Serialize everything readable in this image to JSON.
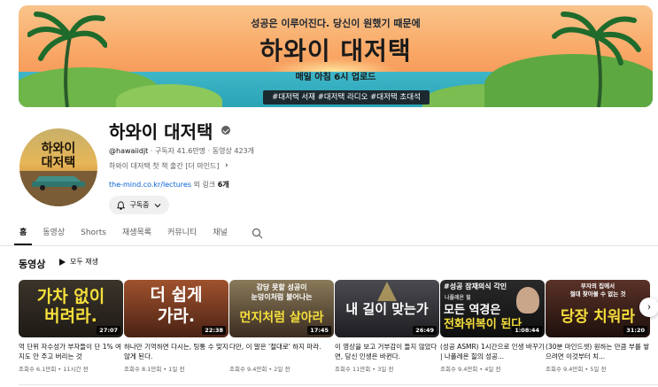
{
  "banner": {
    "top_text": "성공은 이루어진다. 당신이 원했기 때문에",
    "title": "하와이 대저택",
    "subtitle": "매일 아침 6시 업로드",
    "tags": "#대저택 서재 #대저택 라디오 #대저택 초대석"
  },
  "avatar": {
    "line1": "하와이",
    "line2": "대저택"
  },
  "channel": {
    "name": "하와이 대저택",
    "handle": "@hawaiidjt",
    "stats": " · 구독자 41.6만명 · 동영상 423개",
    "description": "하와이 대저택 첫 책 출간 [더 마인드]",
    "link_url": "the-mind.co.kr/lectures",
    "link_more": " 외 링크 ",
    "link_count": "6개",
    "subscribe_label": "구독중"
  },
  "tabs": [
    {
      "label": "홈",
      "active": true
    },
    {
      "label": "동영상",
      "active": false
    },
    {
      "label": "Shorts",
      "active": false
    },
    {
      "label": "재생목록",
      "active": false
    },
    {
      "label": "커뮤니티",
      "active": false
    },
    {
      "label": "채널",
      "active": false
    }
  ],
  "section": {
    "title": "동영상",
    "play_all": "모두 재생"
  },
  "videos": [
    {
      "thumb_text1": "가차 없이",
      "thumb_text2": "버려라.",
      "duration": "27:07",
      "title": "억 단위 자수성가 부자들이 단 1% 여지도 안 주고 버리는 것",
      "meta": "조회수 6.1만회 • 11시간 전",
      "bg": "#2b2620",
      "text_color": "#f6df3c"
    },
    {
      "thumb_text1": "더 쉽게",
      "thumb_text2": "가라.",
      "duration": "22:38",
      "title": "하나만 기억하면 다시는, 팅통 수 맞지 않게 된다.",
      "meta": "조회수 8.1만회 • 1일 전",
      "bg": "#7d3a25",
      "text_color": "#ffffff"
    },
    {
      "thumb_text1": "감당 못할 성공이",
      "thumb_text2": "눈덩이처럼 불어나는",
      "thumb_text3": "먼지처럼 살아라",
      "duration": "17:45",
      "title": "다만, 이 말은 '절대로' 하지 마라.",
      "meta": "조회수 9.4만회 • 2일 전",
      "bg": "#5a4a3a",
      "text_color": "#f6df3c"
    },
    {
      "thumb_text1": "내 길이 맞는가",
      "duration": "26:49",
      "title": "이 영상을 보고 거부감이 들지 않았다면, 당신 인생은 바뀐다.",
      "meta": "조회수 11만회 • 3일 전",
      "bg": "#2a2a2e",
      "text_color": "#ffffff"
    },
    {
      "thumb_text1": "#성공 잠재의식 각인",
      "thumb_text2": "나폴레온 힐",
      "thumb_text3": "모든 역경은",
      "thumb_text4": "전화위복이 된다",
      "duration": "1:08:44",
      "title": "(성공 ASMR) 1시간으로 인생 바꾸기 | 나폴레온 힐의 성공...",
      "meta": "조회수 9.4만회 • 4일 전",
      "bg": "#1a1a1a",
      "text_color": "#ffffff"
    },
    {
      "thumb_text1": "부자의 집에서",
      "thumb_text2": "절대 찾아볼 수 없는 것",
      "thumb_text3": "당장 치워라",
      "duration": "31:20",
      "title": "(30분 마인드셋) 원하는 만큼 부를 쌓으려면 이것부터 치...",
      "meta": "조회수 9.4만회 • 5일 전",
      "bg": "#3a1f1a",
      "text_color": "#f6df3c"
    }
  ]
}
